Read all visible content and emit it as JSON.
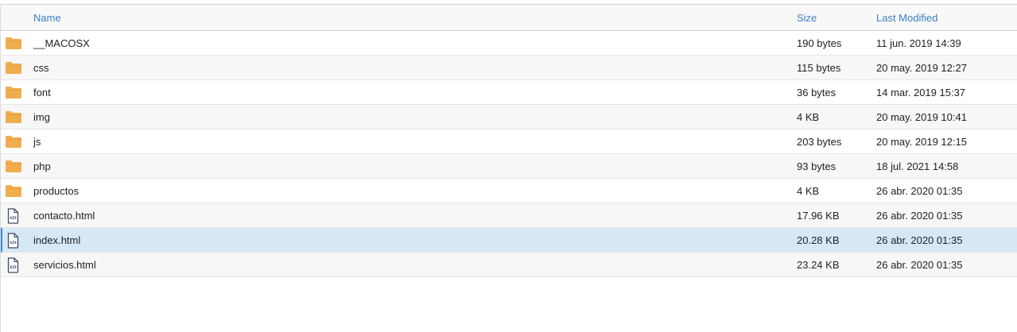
{
  "columns": {
    "name": "Name",
    "size": "Size",
    "modified": "Last Modified"
  },
  "rows": [
    {
      "type": "folder",
      "icon": "folder-icon",
      "name": "__MACOSX",
      "size": "190 bytes",
      "modified": "11 jun. 2019 14:39"
    },
    {
      "type": "folder",
      "icon": "folder-icon",
      "name": "css",
      "size": "115 bytes",
      "modified": "20 may. 2019 12:27"
    },
    {
      "type": "folder",
      "icon": "folder-icon",
      "name": "font",
      "size": "36 bytes",
      "modified": "14 mar. 2019 15:37"
    },
    {
      "type": "folder",
      "icon": "folder-icon",
      "name": "img",
      "size": "4 KB",
      "modified": "20 may. 2019 10:41"
    },
    {
      "type": "folder",
      "icon": "folder-icon",
      "name": "js",
      "size": "203 bytes",
      "modified": "20 may. 2019 12:15"
    },
    {
      "type": "folder",
      "icon": "folder-icon",
      "name": "php",
      "size": "93 bytes",
      "modified": "18 jul. 2021 14:58"
    },
    {
      "type": "folder",
      "icon": "folder-icon",
      "name": "productos",
      "size": "4 KB",
      "modified": "26 abr. 2020 01:35"
    },
    {
      "type": "file",
      "icon": "html-file-icon",
      "name": "contacto.html",
      "size": "17.96 KB",
      "modified": "26 abr. 2020 01:35"
    },
    {
      "type": "file",
      "icon": "html-file-icon",
      "name": "index.html",
      "size": "20.28 KB",
      "modified": "26 abr. 2020 01:35",
      "selected": true
    },
    {
      "type": "file",
      "icon": "html-file-icon",
      "name": "servicios.html",
      "size": "23.24 KB",
      "modified": "26 abr. 2020 01:35"
    }
  ],
  "colors": {
    "folder": "#f0ad4e",
    "file_outline": "#3d4a66",
    "header_text": "#3b7ec5",
    "selected_row": "#d6e8f6",
    "selected_border": "#3f87cf"
  }
}
